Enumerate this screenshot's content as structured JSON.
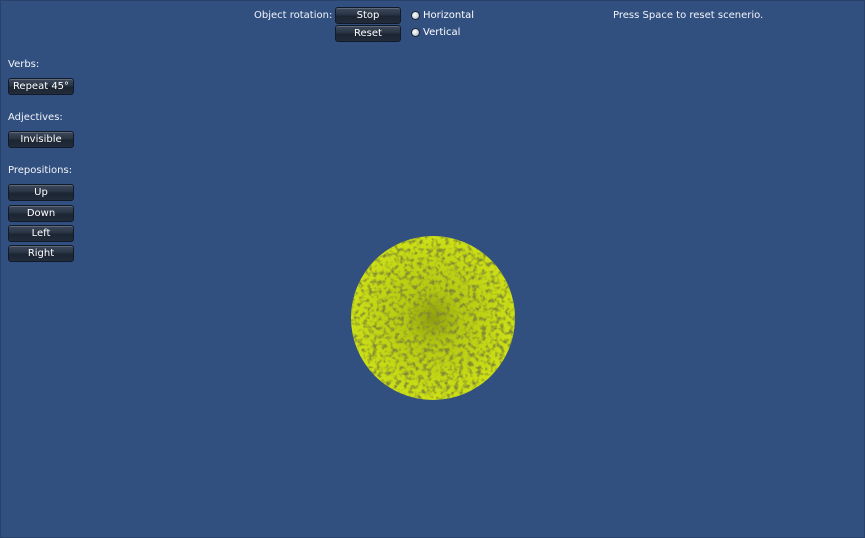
{
  "rotation": {
    "label": "Object rotation:",
    "stop_label": "Stop",
    "reset_label": "Reset",
    "horizontal_label": "Horizontal",
    "vertical_label": "Vertical"
  },
  "hint": "Press Space to reset scenerio.",
  "verbs": {
    "label": "Verbs:",
    "repeat_label": "Repeat 45°"
  },
  "adjectives": {
    "label": "Adjectives:",
    "invisible_label": "Invisible"
  },
  "prepositions": {
    "label": "Prepositions:",
    "up_label": "Up",
    "down_label": "Down",
    "left_label": "Left",
    "right_label": "Right"
  },
  "colors": {
    "background": "#32507f",
    "sphere": "#c8dc10",
    "sphere_shadow": "#3a4406"
  }
}
